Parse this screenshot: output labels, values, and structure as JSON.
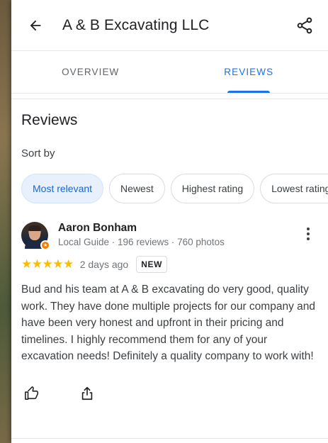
{
  "header": {
    "title": "A & B Excavating LLC",
    "back_icon": "arrow-back-icon",
    "share_icon": "share-icon"
  },
  "tabs": [
    {
      "label": "OVERVIEW",
      "active": false
    },
    {
      "label": "REVIEWS",
      "active": true
    }
  ],
  "reviews_section": {
    "title": "Reviews",
    "sort_label": "Sort by",
    "sort_options": [
      {
        "label": "Most relevant",
        "selected": true
      },
      {
        "label": "Newest",
        "selected": false
      },
      {
        "label": "Highest rating",
        "selected": false
      },
      {
        "label": "Lowest rating",
        "selected": false
      }
    ]
  },
  "review": {
    "author": "Aaron Bonham",
    "meta": "Local Guide · 196 reviews · 760 photos",
    "stars_display": "★★★★★",
    "rating": 5,
    "date": "2 days ago",
    "badge": "NEW",
    "text": "Bud and his team at A & B excavating do very good, quality work. They have done multiple projects for our company and have been very honest and upfront in their pricing and timelines. I highly recommend them for any of your excavation needs! Definitely a quality company to work with!"
  },
  "colors": {
    "accent": "#1a73e8",
    "star": "#fbbc04",
    "chip_selected_bg": "#e8f0fe"
  }
}
